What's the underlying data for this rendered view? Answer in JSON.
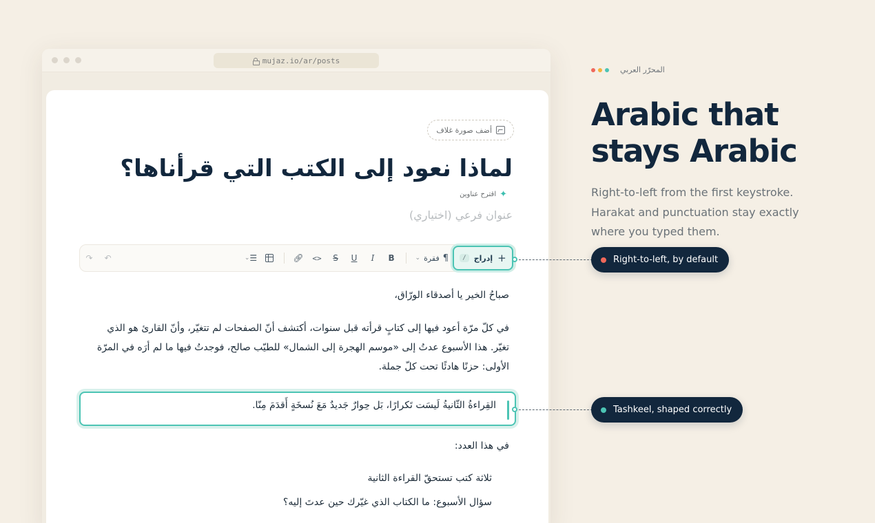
{
  "browser": {
    "url": "mujaz.io/ar/posts"
  },
  "editor": {
    "cover_label": "أضف صورة غلاف",
    "title": "لماذا نعود إلى الكتب التي قرأناها؟",
    "suggest_label": "اقترح عناوين",
    "subtitle_placeholder": "عنوان فرعي (اختياري)",
    "toolbar": {
      "insert_label": "إدراج",
      "insert_shortcut": "/",
      "block_label": "فقرة"
    },
    "paragraphs": {
      "greeting": "صباحُ الخير يا أصدقاء الورّاق،",
      "intro": "في كلّ مرّة أعود فيها إلى كتابٍ قرأته قبل سنوات، أكتشف أنّ الصفحات لم تتغيّر، وأنّ القارئ هو الذي تغيّر. هذا الأسبوع عدتُ إلى «موسم الهجرة إلى الشمال» للطيّب صالح، فوجدتُ فيها ما لم أرَه في المرّة الأولى: حزنًا هادئًا تحت كلّ جملة.",
      "quote": "القِراءةُ الثّانيةُ لَيسَت تَكرارًا، بَل حِوارٌ جَديدٌ مَعَ نُسخَةٍ أَقدَمَ مِنّا.",
      "issue_heading": "في هذا العدد:",
      "list_item_1": "ثلاثة كتب تستحقّ القراءة الثانية",
      "list_item_2": "سؤال الأسبوع: ما الكتاب الذي غيّرك حين عدتَ إليه؟"
    }
  },
  "side": {
    "brand_label": "المحرّر العربي",
    "headline": "Arabic that stays Arabic",
    "description": "Right-to-left from the first keystroke. Harakat and punctuation stay exactly where you typed them.",
    "callouts": [
      {
        "label": "Right-to-left, by default",
        "dot_color": "#f0685a"
      },
      {
        "label": "Tashkeel, shaped correctly",
        "dot_color": "#4cc4b4"
      }
    ],
    "brand_dot_colors": [
      "#f0685a",
      "#f4b33e",
      "#4cc4b4"
    ]
  },
  "colors": {
    "accent": "#4cc4b4",
    "navy": "#12273d",
    "background": "#f5efe5"
  }
}
